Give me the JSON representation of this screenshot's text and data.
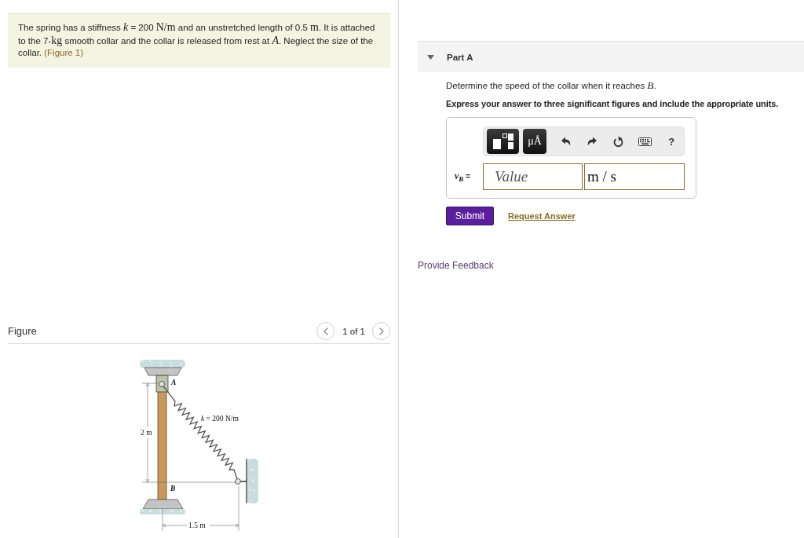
{
  "problem": {
    "segments": [
      {
        "kind": "text",
        "text": "The spring has a stiffness "
      },
      {
        "kind": "variable",
        "text": "k"
      },
      {
        "kind": "text",
        "text": " = 200 "
      },
      {
        "kind": "unit",
        "text": "N/m"
      },
      {
        "kind": "text",
        "text": " and an unstretched length of 0.5 "
      },
      {
        "kind": "unit",
        "text": "m"
      },
      {
        "kind": "text",
        "text": ". It is attached to the 7-"
      },
      {
        "kind": "unit",
        "text": "kg"
      },
      {
        "kind": "text",
        "text": " smooth collar and the collar is released from rest at "
      },
      {
        "kind": "variable",
        "text": "A"
      },
      {
        "kind": "text",
        "text": ". Neglect the size of the collar. "
      },
      {
        "kind": "link",
        "text": "(Figure 1)"
      }
    ]
  },
  "figure": {
    "title": "Figure",
    "pager": "1 of 1",
    "labels": {
      "point_a": "A",
      "spring": "*k* = 200 N/m",
      "height": "2 m",
      "point_b": "B",
      "width": "1.5 m"
    }
  },
  "part": {
    "title": "Part A",
    "expanded": true,
    "question": [
      {
        "kind": "text",
        "text": "Determine the speed of the collar when it reaches "
      },
      {
        "kind": "variable",
        "text": "B"
      },
      {
        "kind": "text",
        "text": "."
      }
    ],
    "instruction": "Express your answer to three significant figures and include the appropriate units.",
    "toolbar": [
      {
        "kind": "templates"
      },
      {
        "kind": "units",
        "label": "μÅ"
      },
      {
        "kind": "undo"
      },
      {
        "kind": "redo"
      },
      {
        "kind": "reset"
      },
      {
        "kind": "keyboard"
      },
      {
        "kind": "help",
        "label": "?"
      }
    ],
    "answer": {
      "label": "*v*$_{B}$ =",
      "value": {
        "placeholder": "Value"
      },
      "units": {
        "value": "m / s"
      }
    },
    "actions": {
      "submit": "Submit",
      "request": "Request Answer"
    }
  },
  "feedback": "Provide Feedback"
}
